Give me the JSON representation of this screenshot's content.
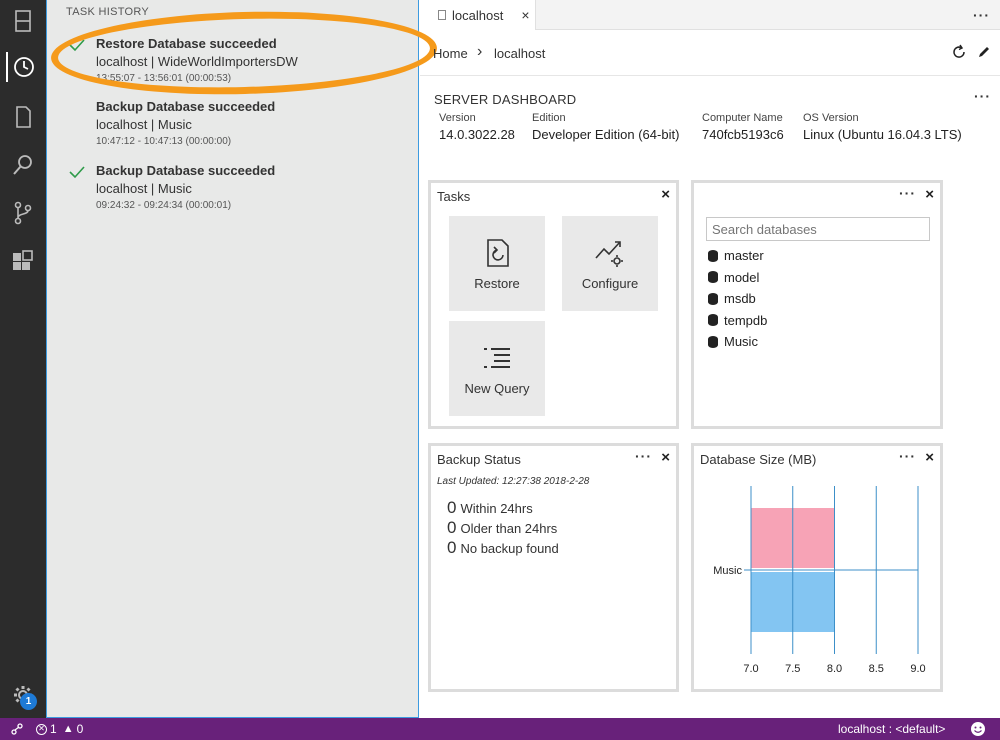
{
  "sidebar": {
    "title": "TASK HISTORY",
    "tasks": [
      {
        "title": "Restore Database succeeded",
        "subtitle": "localhost | WideWorldImportersDW",
        "time": "13:55:07 - 13:56:01 (00:00:53)"
      },
      {
        "title": "Backup Database succeeded",
        "subtitle": "localhost | Music",
        "time": "10:47:12 - 10:47:13 (00:00:00)"
      },
      {
        "title": "Backup Database succeeded",
        "subtitle": "localhost | Music",
        "time": "09:24:32 - 09:24:34 (00:00:01)"
      }
    ]
  },
  "activity": {
    "settings_badge": "1"
  },
  "tab": {
    "label": "localhost",
    "close": "×"
  },
  "breadcrumb": {
    "home": "Home",
    "separator": "›",
    "current": "localhost"
  },
  "dashboard": {
    "title": "SERVER DASHBOARD",
    "props": [
      {
        "label": "Version",
        "value": "14.0.3022.28"
      },
      {
        "label": "Edition",
        "value": "Developer Edition (64-bit)"
      },
      {
        "label": "Computer Name",
        "value": "740fcb5193c6"
      },
      {
        "label": "OS Version",
        "value": "Linux (Ubuntu 16.04.3 LTS)"
      }
    ]
  },
  "tasks_widget": {
    "title": "Tasks",
    "close": "×",
    "buttons": {
      "restore": "Restore",
      "configure": "Configure",
      "new_query": "New Query"
    }
  },
  "databases_widget": {
    "close": "×",
    "search_placeholder": "Search databases",
    "items": [
      "master",
      "model",
      "msdb",
      "tempdb",
      "Music"
    ]
  },
  "backup_widget": {
    "title": "Backup Status",
    "close": "×",
    "last_updated": "Last Updated: 12:27:38 2018-2-28",
    "rows": [
      {
        "count": "0",
        "label": "Within 24hrs"
      },
      {
        "count": "0",
        "label": "Older than 24hrs"
      },
      {
        "count": "0",
        "label": "No backup found"
      }
    ]
  },
  "size_widget": {
    "title": "Database Size (MB)",
    "close": "×"
  },
  "chart_data": {
    "type": "bar",
    "orientation": "horizontal",
    "categories": [
      "Music"
    ],
    "series": [
      {
        "values": [
          8.0
        ],
        "color": "#f7a3b6"
      },
      {
        "values": [
          8.0
        ],
        "color": "#83c5f2"
      }
    ],
    "xlim": [
      7.0,
      9.0
    ],
    "xticks": [
      "7.0",
      "7.5",
      "8.0",
      "8.5",
      "9.0"
    ],
    "grid": true
  },
  "statusbar": {
    "errors": "1",
    "warnings": "0",
    "connection": "localhost : <default>"
  },
  "colors": {
    "statusbar": "#68217a",
    "accent_border": "#3c9be0",
    "highlight": "#f59a1b",
    "success_check": "#2e9b4a"
  }
}
